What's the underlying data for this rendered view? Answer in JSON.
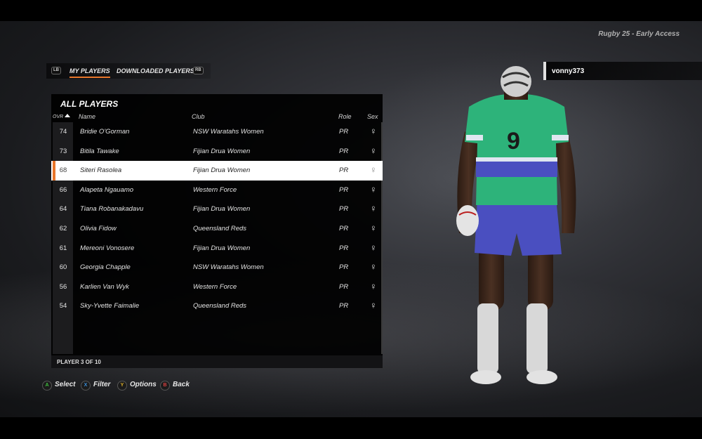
{
  "game_title": "Rugby 25 - Early Access",
  "tabs": {
    "left_bumper": "LB",
    "right_bumper": "RB",
    "items": [
      {
        "label": "MY PLAYERS",
        "active": true
      },
      {
        "label": "DOWNLOADED PLAYERS",
        "active": false
      }
    ]
  },
  "panel": {
    "title": "ALL PLAYERS",
    "columns": {
      "ovr": "OVR",
      "name": "Name",
      "club": "Club",
      "role": "Role",
      "sex": "Sex"
    },
    "rows": [
      {
        "ovr": "74",
        "name": "Bridie O'Gorman",
        "club": "NSW Waratahs Women",
        "role": "PR",
        "sex": "♀"
      },
      {
        "ovr": "73",
        "name": "Bitila Tawake",
        "club": "Fijian Drua Women",
        "role": "PR",
        "sex": "♀"
      },
      {
        "ovr": "68",
        "name": "Siteri Rasolea",
        "club": "Fijian Drua Women",
        "role": "PR",
        "sex": "♀",
        "selected": true
      },
      {
        "ovr": "66",
        "name": "Alapeta Ngauamo",
        "club": "Western Force",
        "role": "PR",
        "sex": "♀"
      },
      {
        "ovr": "64",
        "name": "Tiana Robanakadavu",
        "club": "Fijian Drua Women",
        "role": "PR",
        "sex": "♀"
      },
      {
        "ovr": "62",
        "name": "Olivia Fidow",
        "club": "Queensland Reds",
        "role": "PR",
        "sex": "♀"
      },
      {
        "ovr": "61",
        "name": "Mereoni Vonosere",
        "club": "Fijian Drua Women",
        "role": "PR",
        "sex": "♀"
      },
      {
        "ovr": "60",
        "name": "Georgia Chapple",
        "club": "NSW Waratahs Women",
        "role": "PR",
        "sex": "♀"
      },
      {
        "ovr": "56",
        "name": "Karlien Van Wyk",
        "club": "Western Force",
        "role": "PR",
        "sex": "♀"
      },
      {
        "ovr": "54",
        "name": "Sky-Yvette Faimalie",
        "club": "Queensland Reds",
        "role": "PR",
        "sex": "♀"
      }
    ],
    "footer": "PLAYER 3 OF 10"
  },
  "user": {
    "name": "vonny373"
  },
  "player_preview": {
    "jersey_number": "9"
  },
  "prompts": [
    {
      "key": "A",
      "label": "Select",
      "icon": "a-button-icon"
    },
    {
      "key": "X",
      "label": "Filter",
      "icon": "x-button-icon"
    },
    {
      "key": "Y",
      "label": "Options",
      "icon": "y-button-icon"
    },
    {
      "key": "B",
      "label": "Back",
      "icon": "b-button-icon"
    }
  ],
  "colors": {
    "accent": "#e8762b",
    "jersey_green": "#2db37a",
    "jersey_blue": "#4a4fc0"
  }
}
